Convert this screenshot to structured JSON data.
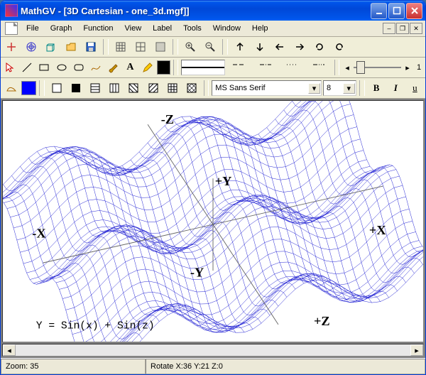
{
  "window": {
    "title": "MathGV - [3D Cartesian - one_3d.mgf]]"
  },
  "menubar": {
    "items": [
      "File",
      "Graph",
      "Function",
      "View",
      "Label",
      "Tools",
      "Window",
      "Help"
    ]
  },
  "toolbar1": {
    "icons": [
      "new-2d-icon",
      "new-polar-icon",
      "new-3d-icon",
      "open-icon",
      "save-icon"
    ],
    "icons_group2": [
      "grid-a-icon",
      "grid-b-icon",
      "grid-c-icon"
    ],
    "icons_zoom": [
      "zoom-in-icon",
      "zoom-out-icon"
    ],
    "icons_arrows": [
      "arrow-up-icon",
      "arrow-down-icon",
      "arrow-left-icon",
      "arrow-right-icon",
      "rotate-ccw-icon",
      "rotate-cw-icon"
    ]
  },
  "toolbar2": {
    "tool_icons": [
      "pointer-icon",
      "line-icon",
      "rect-icon",
      "ellipse-icon",
      "rounded-rect-icon",
      "freehand-icon",
      "brush-icon",
      "text-icon",
      "pencil-icon"
    ],
    "color_swatch": "#000000",
    "line_styles": [
      "solid",
      "dash",
      "dash-dot",
      "dot",
      "dash-dot-dot"
    ],
    "slider_label": "1"
  },
  "toolbar3": {
    "shape_icon": "region-icon",
    "fill_swatch": "#0000FF",
    "pattern_icons": [
      "pattern-none-icon",
      "pattern-solid-icon",
      "pattern-hatch1-icon",
      "pattern-hatch2-icon",
      "pattern-hatch3-icon",
      "pattern-hatch4-icon",
      "pattern-cross-icon",
      "pattern-diagcross-icon"
    ],
    "font_name": "MS Sans Serif",
    "font_size": "8",
    "style_icons": [
      "bold-icon",
      "italic-icon",
      "underline-icon"
    ],
    "style_labels": {
      "bold": "B",
      "italic": "I",
      "underline": "u"
    }
  },
  "plot": {
    "equation": "Y = Sin(x) + Sin(z)",
    "axis_labels": {
      "neg_z": "-Z",
      "pos_z": "+Z",
      "neg_x": "-X",
      "pos_x": "+X",
      "neg_y": "-Y",
      "pos_y": "+Y"
    },
    "mesh_color": "#1010d0"
  },
  "statusbar": {
    "zoom": "Zoom: 35",
    "rotate": "Rotate X:36 Y:21 Z:0"
  },
  "chart_data": {
    "type": "surface-3d",
    "title": "3D Cartesian",
    "function": "y = sin(x) + sin(z)",
    "x_range": [
      -8,
      8
    ],
    "z_range": [
      -8,
      8
    ],
    "y_range": [
      -2,
      2
    ],
    "view_rotation": {
      "x": 36,
      "y": 21,
      "z": 0
    },
    "zoom": 35,
    "mesh_color": "#1010d0",
    "wireframe": true,
    "note": "Rendered as dense wireframe mesh; values are continuous, sampled on a grid over x,z."
  }
}
